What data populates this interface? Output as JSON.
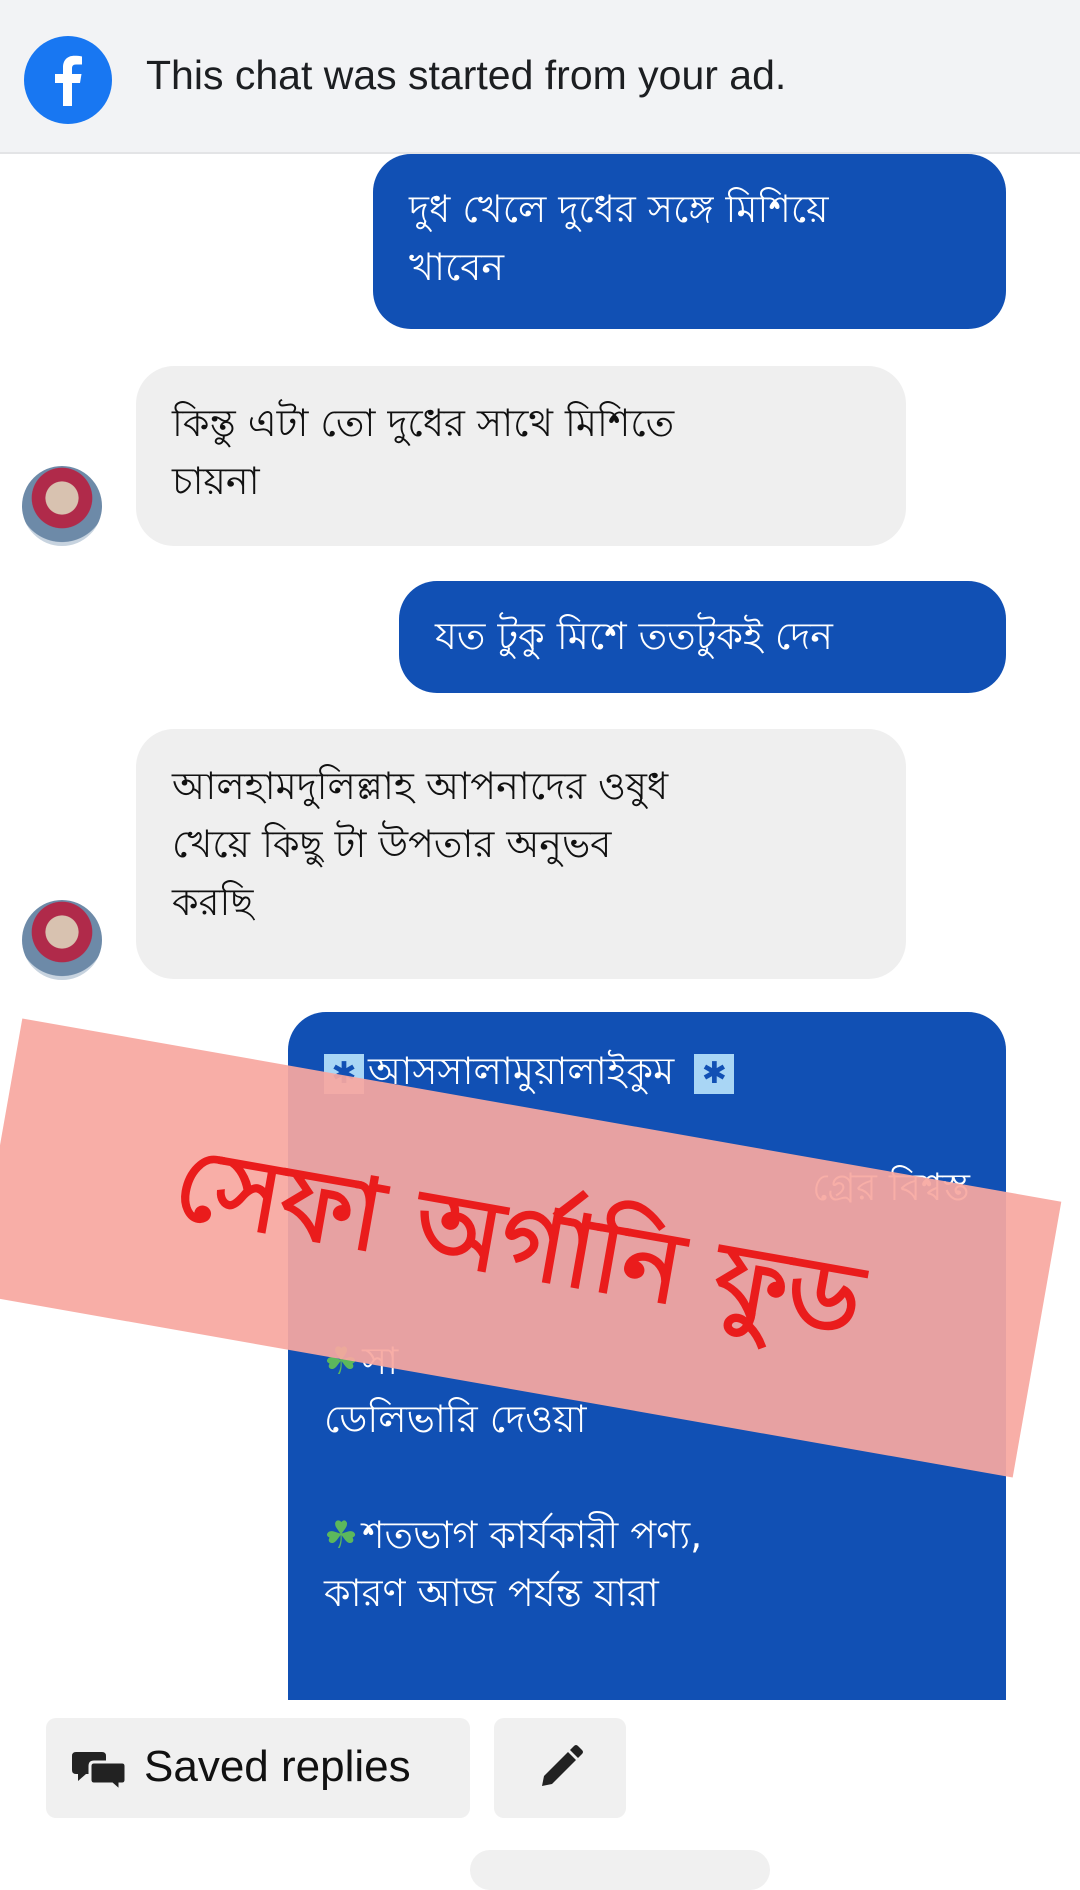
{
  "banner": {
    "icon": "facebook-icon",
    "text": "This chat was started from your ad."
  },
  "messages": [
    {
      "direction": "outgoing",
      "lines": [
        "দুধ খেলে দুধের সঙ্গে মিশিয়ে",
        "খাবেন"
      ]
    },
    {
      "direction": "incoming",
      "lines": [
        "কিন্তু এটা তো দুধের সাথে মিশিতে",
        "চায়না"
      ]
    },
    {
      "direction": "outgoing",
      "lines": [
        "যত টুকু মিশে ততটুকই দেন"
      ]
    },
    {
      "direction": "incoming",
      "lines": [
        "আলহামদুলিল্লাহ আপনাদের ওষুধ",
        "খেয়ে কিছু টা উপতার অনুভব",
        "করছি"
      ]
    }
  ],
  "long_message": {
    "greeting": "আসসালামুয়ালাইকুম",
    "line_partial": "গ্রের বিশ্বস্ত",
    "clover1_partial": "সা",
    "delivery_partial": "ডেলিভারি দেওয়া",
    "clover2": "শতভাগ  কার্যকারী পণ্য,",
    "last_line": "কারণ আজ পর্যন্ত যারা"
  },
  "watermark": {
    "text": "সেফা অর্গানি ফুড"
  },
  "composer": {
    "saved_replies_label": "Saved replies",
    "saved_icon": "chat-bubbles-icon",
    "edit_icon": "pencil-icon"
  }
}
